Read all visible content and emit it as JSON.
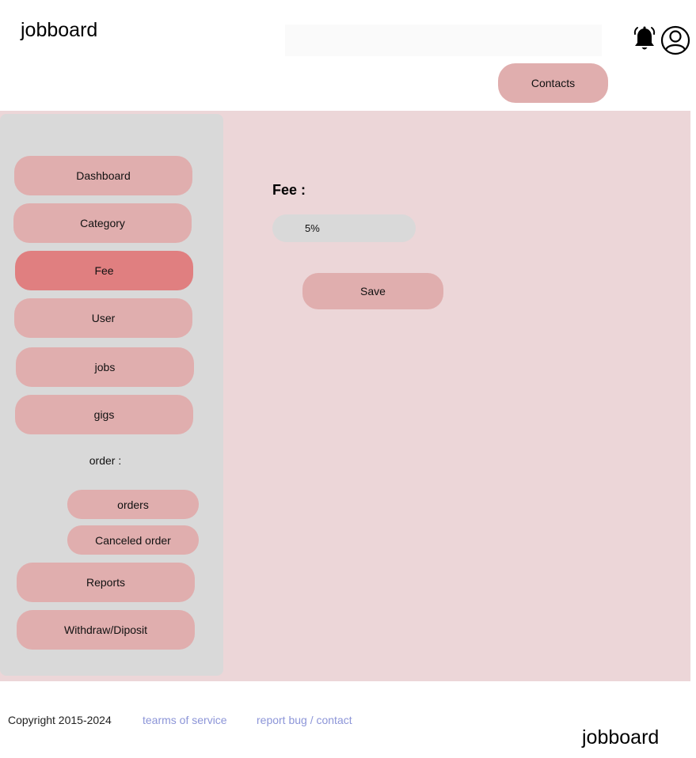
{
  "header": {
    "brand": "jobboard",
    "search": {
      "value": "",
      "placeholder": ""
    },
    "contacts_label": "Contacts",
    "icons": {
      "notifications": "bell-icon",
      "profile": "user-circle-icon"
    }
  },
  "sidebar": {
    "items": [
      {
        "label": "Dashboard"
      },
      {
        "label": "Category"
      },
      {
        "label": "Fee"
      },
      {
        "label": "User"
      },
      {
        "label": "jobs"
      },
      {
        "label": "gigs"
      }
    ],
    "order_group": {
      "label": "order :",
      "items": [
        {
          "label": "orders"
        },
        {
          "label": "Canceled order"
        }
      ]
    },
    "bottom_items": [
      {
        "label": "Reports"
      },
      {
        "label": "Withdraw/Diposit"
      }
    ],
    "active_item": "Fee"
  },
  "main": {
    "fee_label": "Fee :",
    "fee_value": "5%",
    "save_label": "Save"
  },
  "footer": {
    "copyright": "Copyright 2015-2024",
    "terms_label": "tearms of service",
    "report_label": "report bug / contact",
    "brand": "jobboard"
  },
  "colors": {
    "accent": "#e0aeae",
    "active": "#e07f80",
    "main_bg": "#ecd6d8",
    "sidebar_bg": "#d9d9d9",
    "link": "#8c95d8"
  }
}
